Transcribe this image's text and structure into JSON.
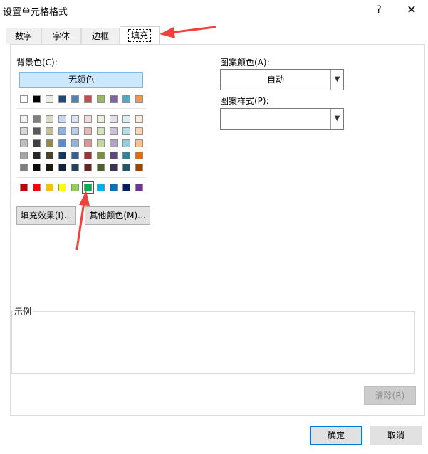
{
  "window": {
    "title": "设置单元格格式",
    "help_icon": "?",
    "close_icon": "✕"
  },
  "tabs": [
    {
      "label": "数字"
    },
    {
      "label": "字体"
    },
    {
      "label": "边框"
    },
    {
      "label": "填充"
    }
  ],
  "fill": {
    "background_label": "背景色(C):",
    "no_color_label": "无颜色",
    "theme_top_row": [
      "#ffffff",
      "#000000",
      "#eeece1",
      "#1f497d",
      "#4f81bd",
      "#c0504d",
      "#9bbb59",
      "#8064a2",
      "#4bacc6",
      "#f79646"
    ],
    "theme_shades": [
      [
        "#f2f2f2",
        "#7f7f7f",
        "#ddd9c4",
        "#c6d9f0",
        "#dbe5f1",
        "#f2dcdb",
        "#ebf1dd",
        "#e5e0ec",
        "#dbeef3",
        "#fdeada"
      ],
      [
        "#d8d8d8",
        "#595959",
        "#c4bd97",
        "#8db3e2",
        "#b8cce4",
        "#e5b9b7",
        "#d7e3bc",
        "#ccc1d9",
        "#b7dde8",
        "#fbd5b5"
      ],
      [
        "#bfbfbf",
        "#3f3f3f",
        "#938953",
        "#548dd4",
        "#95b3d7",
        "#d99694",
        "#c3d69b",
        "#b2a2c7",
        "#92cddc",
        "#fac08f"
      ],
      [
        "#a5a5a5",
        "#262626",
        "#494429",
        "#17365d",
        "#366092",
        "#953734",
        "#76923c",
        "#5f497a",
        "#31859b",
        "#e36c09"
      ],
      [
        "#7f7f7f",
        "#0c0c0c",
        "#1d1b10",
        "#0f243e",
        "#244061",
        "#632423",
        "#4f6128",
        "#3f3151",
        "#205867",
        "#974806"
      ]
    ],
    "standard_colors": [
      "#c00000",
      "#ff0000",
      "#ffc000",
      "#ffff00",
      "#92d050",
      "#00b050",
      "#00b0f0",
      "#0070c0",
      "#002060",
      "#7030a0"
    ],
    "selected_standard_index": 5,
    "fill_effects_label": "填充效果(I)...",
    "more_colors_label": "其他颜色(M)...",
    "pattern_color_label": "图案颜色(A):",
    "pattern_color_value": "自动",
    "pattern_style_label": "图案样式(P):",
    "pattern_style_value": "",
    "sample_label": "示例",
    "clear_label": "清除(R)"
  },
  "footer": {
    "ok_label": "确定",
    "cancel_label": "取消"
  },
  "colors": {
    "accent": "#0078d7",
    "no_color_bg": "#cce8ff",
    "annotation_red": "#f0413c"
  }
}
